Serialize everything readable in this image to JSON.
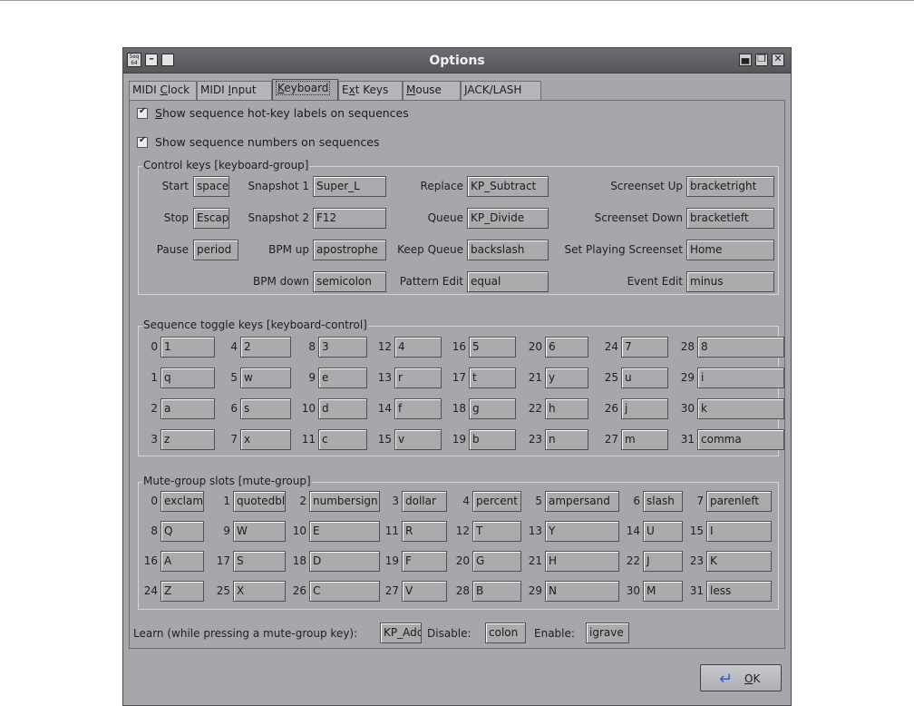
{
  "window": {
    "title": "Options",
    "app_icon_text": "Seq 64"
  },
  "tabs": [
    {
      "pre": "MIDI ",
      "ul": "C",
      "post": "lock",
      "active": false
    },
    {
      "pre": "MIDI ",
      "ul": "I",
      "post": "nput",
      "active": false
    },
    {
      "pre": "",
      "ul": "K",
      "post": "eyboard",
      "active": true
    },
    {
      "pre": "E",
      "ul": "x",
      "post": "t Keys",
      "active": false
    },
    {
      "pre": "",
      "ul": "M",
      "post": "ouse",
      "active": false
    },
    {
      "pre": "",
      "ul": "J",
      "post": "ACK/LASH",
      "active": false
    }
  ],
  "checks": {
    "hotkey": {
      "ul": "S",
      "rest": "how sequence hot-key labels on sequences",
      "checked": true
    },
    "numbers": {
      "label": "Show sequence numbers on sequences",
      "checked": true
    }
  },
  "control_group": {
    "title": "Control keys [keyboard-group]",
    "start": {
      "label": "Start",
      "value": "space"
    },
    "stop": {
      "label": "Stop",
      "value": "Escape"
    },
    "pause": {
      "label": "Pause",
      "value": "period"
    },
    "snapshot1": {
      "label": "Snapshot 1",
      "value": "Super_L"
    },
    "snapshot2": {
      "label": "Snapshot 2",
      "value": "F12"
    },
    "bpm_up": {
      "label": "BPM up",
      "value": "apostrophe"
    },
    "bpm_down": {
      "label": "BPM down",
      "value": "semicolon"
    },
    "replace": {
      "label": "Replace",
      "value": "KP_Subtract"
    },
    "queue": {
      "label": "Queue",
      "value": "KP_Divide"
    },
    "keep_queue": {
      "label": "Keep Queue",
      "value": "backslash"
    },
    "pattern_edit": {
      "label": "Pattern Edit",
      "value": "equal"
    },
    "screenset_up": {
      "label": "Screenset Up",
      "value": "bracketright"
    },
    "screenset_down": {
      "label": "Screenset Down",
      "value": "bracketleft"
    },
    "set_playing": {
      "label": "Set Playing Screenset",
      "value": "Home"
    },
    "event_edit": {
      "label": "Event Edit",
      "value": "minus"
    }
  },
  "sequence_group": {
    "title": "Sequence toggle keys [keyboard-control]",
    "keys": [
      {
        "n": "0",
        "v": "1"
      },
      {
        "n": "4",
        "v": "2"
      },
      {
        "n": "8",
        "v": "3"
      },
      {
        "n": "12",
        "v": "4"
      },
      {
        "n": "16",
        "v": "5"
      },
      {
        "n": "20",
        "v": "6"
      },
      {
        "n": "24",
        "v": "7"
      },
      {
        "n": "28",
        "v": "8"
      },
      {
        "n": "1",
        "v": "q"
      },
      {
        "n": "5",
        "v": "w"
      },
      {
        "n": "9",
        "v": "e"
      },
      {
        "n": "13",
        "v": "r"
      },
      {
        "n": "17",
        "v": "t"
      },
      {
        "n": "21",
        "v": "y"
      },
      {
        "n": "25",
        "v": "u"
      },
      {
        "n": "29",
        "v": "i"
      },
      {
        "n": "2",
        "v": "a"
      },
      {
        "n": "6",
        "v": "s"
      },
      {
        "n": "10",
        "v": "d"
      },
      {
        "n": "14",
        "v": "f"
      },
      {
        "n": "18",
        "v": "g"
      },
      {
        "n": "22",
        "v": "h"
      },
      {
        "n": "26",
        "v": "j"
      },
      {
        "n": "30",
        "v": "k"
      },
      {
        "n": "3",
        "v": "z"
      },
      {
        "n": "7",
        "v": "x"
      },
      {
        "n": "11",
        "v": "c"
      },
      {
        "n": "15",
        "v": "v"
      },
      {
        "n": "19",
        "v": "b"
      },
      {
        "n": "23",
        "v": "n"
      },
      {
        "n": "27",
        "v": "m"
      },
      {
        "n": "31",
        "v": "comma"
      }
    ]
  },
  "mute_group": {
    "title": "Mute-group slots [mute-group]",
    "slots": [
      {
        "n": "0",
        "v": "exclam"
      },
      {
        "n": "1",
        "v": "quotedbl"
      },
      {
        "n": "2",
        "v": "numbersign"
      },
      {
        "n": "3",
        "v": "dollar"
      },
      {
        "n": "4",
        "v": "percent"
      },
      {
        "n": "5",
        "v": "ampersand"
      },
      {
        "n": "6",
        "v": "slash"
      },
      {
        "n": "7",
        "v": "parenleft"
      },
      {
        "n": "8",
        "v": "Q"
      },
      {
        "n": "9",
        "v": "W"
      },
      {
        "n": "10",
        "v": "E"
      },
      {
        "n": "11",
        "v": "R"
      },
      {
        "n": "12",
        "v": "T"
      },
      {
        "n": "13",
        "v": "Y"
      },
      {
        "n": "14",
        "v": "U"
      },
      {
        "n": "15",
        "v": "I"
      },
      {
        "n": "16",
        "v": "A"
      },
      {
        "n": "17",
        "v": "S"
      },
      {
        "n": "18",
        "v": "D"
      },
      {
        "n": "19",
        "v": "F"
      },
      {
        "n": "20",
        "v": "G"
      },
      {
        "n": "21",
        "v": "H"
      },
      {
        "n": "22",
        "v": "J"
      },
      {
        "n": "23",
        "v": "K"
      },
      {
        "n": "24",
        "v": "Z"
      },
      {
        "n": "25",
        "v": "X"
      },
      {
        "n": "26",
        "v": "C"
      },
      {
        "n": "27",
        "v": "V"
      },
      {
        "n": "28",
        "v": "B"
      },
      {
        "n": "29",
        "v": "N"
      },
      {
        "n": "30",
        "v": "M"
      },
      {
        "n": "31",
        "v": "less"
      }
    ]
  },
  "learn": {
    "label": "Learn (while pressing a mute-group key):",
    "learn_value": "KP_Add",
    "disable_label": "Disable:",
    "disable_value": "colon",
    "enable_label": "Enable:",
    "enable_value": "igrave"
  },
  "ok_button": {
    "ul": "O",
    "rest": "K"
  },
  "colors": {
    "window_bg": "#a5a7aa",
    "titlebar": "#5f6165",
    "field_bg": "#ababae",
    "title_text": "#f2f2f2"
  }
}
